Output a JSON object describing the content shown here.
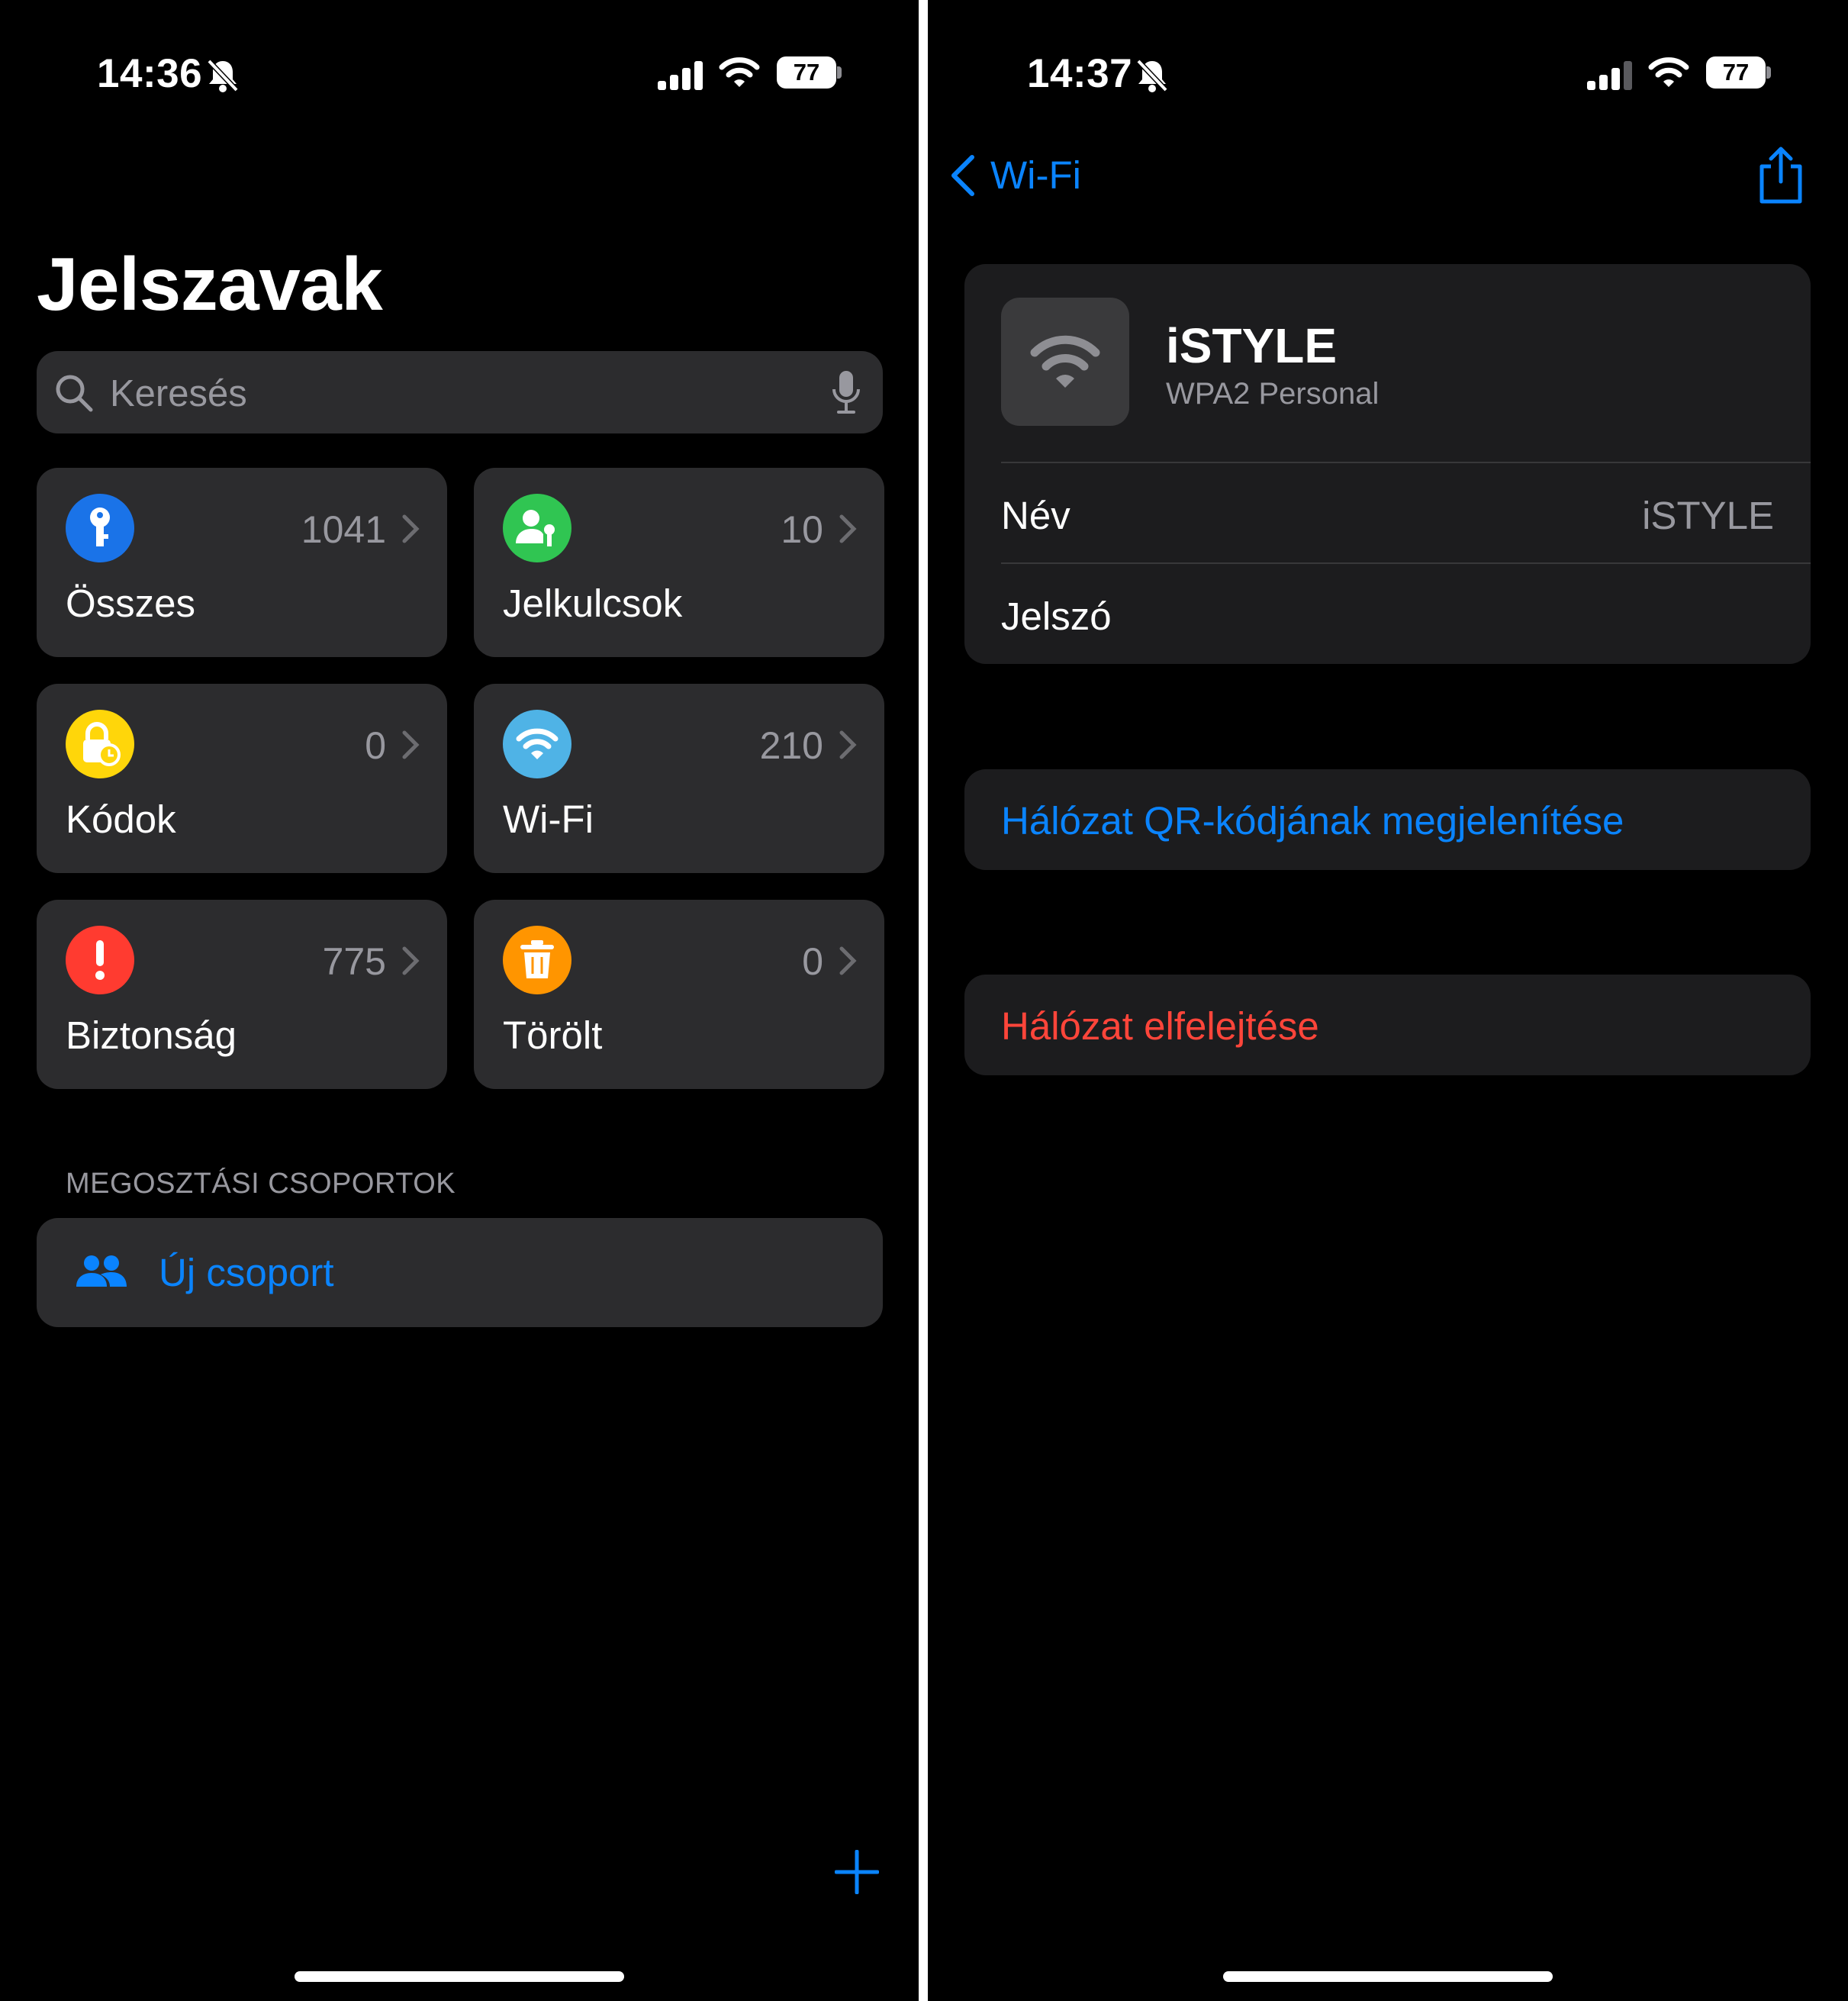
{
  "colors": {
    "accent": "#0a84ff",
    "destructive": "#ff453a",
    "tile_bg": "#2c2c2e",
    "card_bg": "#1c1c1e"
  },
  "left": {
    "status": {
      "time": "14:36",
      "battery": "77"
    },
    "title": "Jelszavak",
    "search": {
      "placeholder": "Keresés",
      "icon": "search-icon",
      "mic_icon": "microphone-icon"
    },
    "tiles": [
      {
        "label": "Összes",
        "count": "1041",
        "icon": "key-icon",
        "color": "#1a73e8"
      },
      {
        "label": "Jelkulcsok",
        "count": "10",
        "icon": "passkey-icon",
        "color": "#30c552"
      },
      {
        "label": "Kódok",
        "count": "0",
        "icon": "lock-clock-icon",
        "color": "#ffd60a"
      },
      {
        "label": "Wi-Fi",
        "count": "210",
        "icon": "wifi-icon",
        "color": "#4fb3e6"
      },
      {
        "label": "Biztonság",
        "count": "775",
        "icon": "exclamation-icon",
        "color": "#ff3b30"
      },
      {
        "label": "Törölt",
        "count": "0",
        "icon": "trash-icon",
        "color": "#ff9500"
      }
    ],
    "section_header": "MEGOSZTÁSI CSOPORTOK",
    "new_group": "Új csoport"
  },
  "right": {
    "status": {
      "time": "14:37",
      "battery": "77"
    },
    "back_label": "Wi-Fi",
    "network": {
      "name": "iSTYLE",
      "security": "WPA2 Personal",
      "name_label": "Név",
      "name_value": "iSTYLE",
      "password_label": "Jelszó"
    },
    "show_qr": "Hálózat QR-kódjának megjelenítése",
    "forget": "Hálózat elfelejtése"
  }
}
